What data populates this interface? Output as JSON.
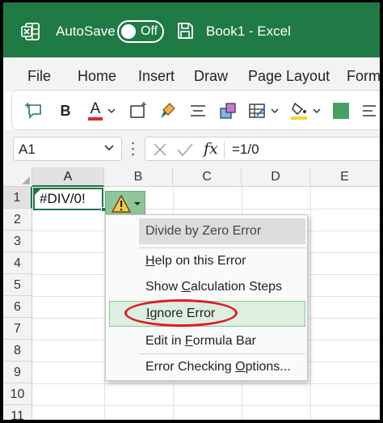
{
  "theme": {
    "brand": "#1f7a45",
    "accent": "#217346",
    "highlight": "#dcefe0",
    "ring": "#e01b24"
  },
  "titlebar": {
    "app_icon": "excel-icon",
    "autosave_label": "AutoSave",
    "autosave_state": "Off",
    "save_icon": "save-icon",
    "title": "Book1  -  Excel"
  },
  "menu_tabs": [
    "File",
    "Home",
    "Insert",
    "Draw",
    "Page Layout",
    "Form"
  ],
  "ribbon": {
    "bold_label": "B",
    "font_color_label": "A"
  },
  "formula_bar": {
    "name_box": "A1",
    "fx_label": "fx",
    "formula": "=1/0"
  },
  "grid": {
    "columns": [
      "A",
      "B",
      "C",
      "D",
      "E"
    ],
    "rows": [
      "1",
      "2",
      "3",
      "4",
      "5",
      "6",
      "7",
      "8",
      "9",
      "10",
      "11"
    ],
    "active_cell": {
      "ref": "A1",
      "value": "#DIV/0!"
    }
  },
  "error_menu": {
    "header": "Divide by Zero Error",
    "items": [
      {
        "pre": "",
        "key": "H",
        "post": "elp on this Error"
      },
      {
        "pre": "Show ",
        "key": "C",
        "post": "alculation Steps"
      },
      {
        "pre": "",
        "key": "I",
        "post": "gnore Error"
      },
      {
        "pre": "Edit in ",
        "key": "F",
        "post": "ormula Bar"
      },
      {
        "pre": "Error Checking ",
        "key": "O",
        "post": "ptions..."
      }
    ]
  }
}
